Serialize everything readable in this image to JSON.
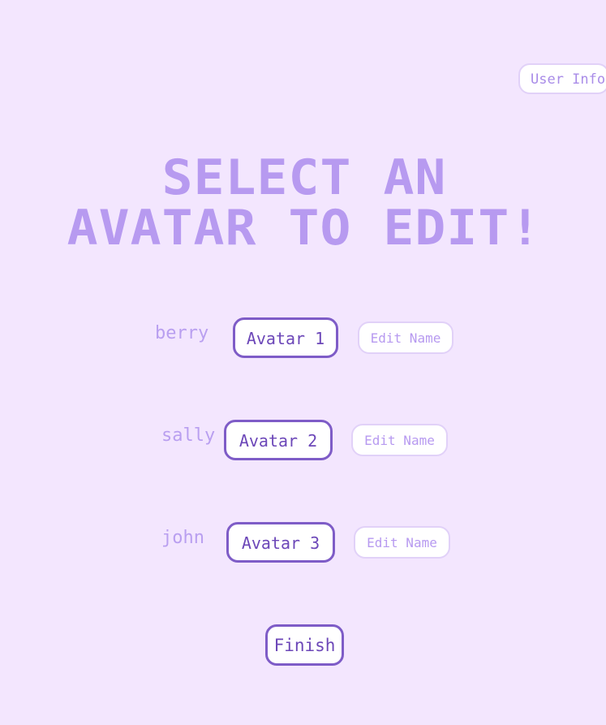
{
  "header": {
    "user_info_label": "User Info"
  },
  "title": {
    "line1": "SELECT AN",
    "line2": "AVATAR TO EDIT!"
  },
  "avatars": [
    {
      "name": "berry",
      "button_label": "Avatar 1",
      "edit_label": "Edit Name"
    },
    {
      "name": "sally",
      "button_label": "Avatar 2",
      "edit_label": "Edit Name"
    },
    {
      "name": "john",
      "button_label": "Avatar 3",
      "edit_label": "Edit Name"
    }
  ],
  "footer": {
    "finish_label": "Finish"
  },
  "colors": {
    "background": "#f3e6fe",
    "title": "#b79af0",
    "primary_border": "#7e5cc7",
    "primary_text": "#6c47b8",
    "secondary_border": "#e1d1f8",
    "secondary_text": "#b79af0"
  }
}
